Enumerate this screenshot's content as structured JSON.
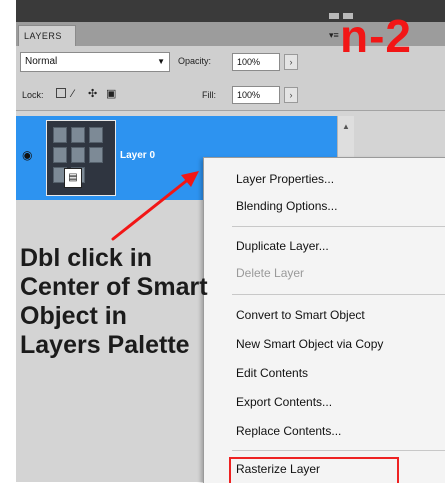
{
  "panel": {
    "tab": "LAYERS",
    "menu_glyph": "▾≡",
    "blend_mode": "Normal",
    "opacity_label": "Opacity:",
    "opacity_value": "100%",
    "lock_label": "Lock:",
    "fill_label": "Fill:",
    "fill_value": "100%"
  },
  "layer": {
    "name": "Layer 0",
    "visibility_icon": "eye-icon",
    "type_icon": "smart-object-icon"
  },
  "context_menu": {
    "items": [
      {
        "label": "Layer Properties...",
        "enabled": true
      },
      {
        "label": "Blending Options...",
        "enabled": true
      },
      {
        "label": "Duplicate Layer...",
        "enabled": true
      },
      {
        "label": "Delete Layer",
        "enabled": false
      },
      {
        "label": "Convert to Smart Object",
        "enabled": true
      },
      {
        "label": "New Smart Object via Copy",
        "enabled": true
      },
      {
        "label": "Edit Contents",
        "enabled": true
      },
      {
        "label": "Export Contents...",
        "enabled": true
      },
      {
        "label": "Replace Contents...",
        "enabled": true
      },
      {
        "label": "Rasterize Layer",
        "enabled": true,
        "highlighted": true
      }
    ]
  },
  "annotation": {
    "badge": "n-2",
    "lines": [
      "Dbl click in",
      "Center of Smart",
      "Object  in",
      "Layers Palette"
    ],
    "accent_color": "#f21616"
  }
}
